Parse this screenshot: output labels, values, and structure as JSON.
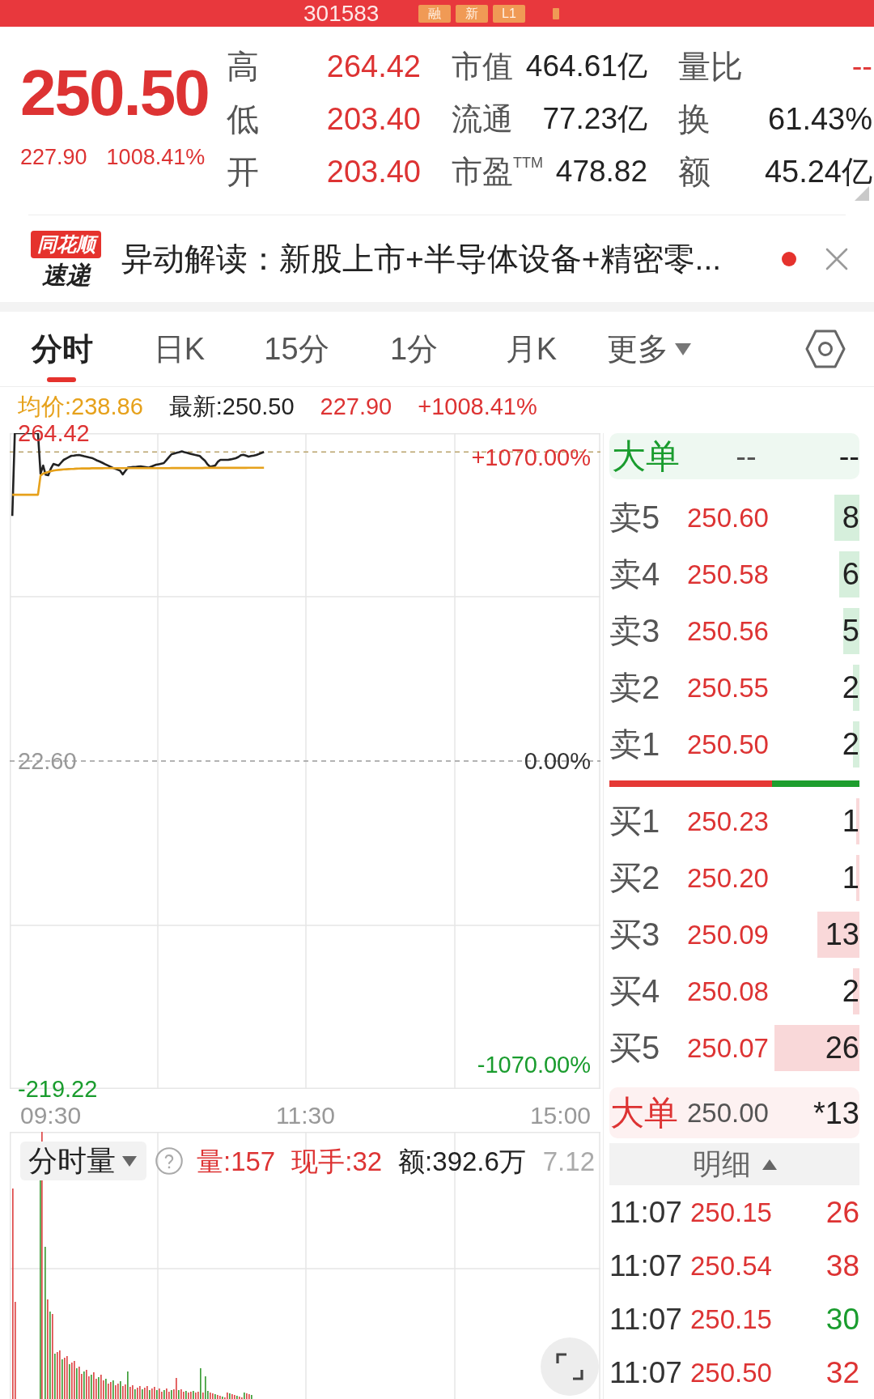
{
  "header": {
    "code": "301583",
    "badges": [
      "融",
      "新",
      "L1"
    ]
  },
  "quote": {
    "price": "250.50",
    "change": "227.90",
    "change_pct": "1008.41%",
    "col_1": [
      {
        "label": "高",
        "value": "264.42"
      },
      {
        "label": "低",
        "value": "203.40"
      },
      {
        "label": "开",
        "value": "203.40"
      }
    ],
    "col_2": [
      {
        "label": "市值",
        "value": "464.61亿"
      },
      {
        "label": "流通",
        "value": "77.23亿"
      },
      {
        "label": "市盈$^{TTM}$",
        "value": "478.82"
      }
    ],
    "col_3": [
      {
        "label": "量比",
        "value": "--",
        "color": "#e03c3c"
      },
      {
        "label": "换",
        "value": "61.43%",
        "color": "#222222"
      },
      {
        "label": "额",
        "value": "45.24亿",
        "color": "#222222"
      }
    ]
  },
  "news": {
    "logo_title": "同花顺",
    "logo_subtitle": "速递",
    "text": "异动解读：新股上市+半导体设备+精密零...",
    "unread": true
  },
  "tabs": [
    {
      "label": "分时",
      "selected": true,
      "kind": "tab"
    },
    {
      "label": "日K",
      "selected": false,
      "kind": "tab"
    },
    {
      "label": "15分",
      "selected": false,
      "kind": "tab"
    },
    {
      "label": "1分",
      "selected": false,
      "kind": "tab"
    },
    {
      "label": "月K",
      "selected": false,
      "kind": "tab"
    },
    {
      "label": "更多",
      "selected": false,
      "kind": "menu"
    }
  ],
  "chart": {
    "legend": [
      {
        "text": "均价:238.86",
        "color": "#e6a11b"
      },
      {
        "text": "最新:250.50",
        "color": "#222222"
      },
      {
        "text": "227.90",
        "color": "#dd3333"
      },
      {
        "text": "+1008.41%",
        "color": "#dd3333"
      }
    ],
    "chart_data": {
      "type": "line",
      "series": [
        {
          "color": "#222222",
          "values": [
            null,
            203.4,
            264.4,
            264.4,
            264.4,
            264.4,
            264.4,
            264.4,
            264.4,
            264.4,
            264.4,
            264.4,
            234.7,
            240.5,
            233.8,
            233.4,
            238.2,
            241.7,
            241.1,
            240.5,
            242.6,
            244.7,
            245.7,
            246.7,
            247.7,
            247.9,
            248.1,
            248.3,
            247.9,
            247.4,
            247.0,
            246.5,
            246.1,
            245.2,
            244.3,
            243.5,
            242.6,
            241.7,
            240.8,
            239.9,
            239.0,
            238.2,
            237.5,
            236.7,
            234.0,
            236.5,
            239.0,
            239.2,
            239.4,
            239.5,
            239.7,
            239.9,
            239.6,
            239.3,
            239.0,
            239.7,
            240.4,
            241.1,
            241.5,
            241.9,
            242.3,
            244.5,
            246.7,
            248.9,
            249.4,
            249.9,
            250.4,
            250.9,
            250.4,
            249.9,
            249.4,
            248.9,
            248.4,
            248.0,
            247.5,
            245.8,
            244.1,
            241.4,
            239.7,
            240.1,
            240.5,
            243.3,
            244.7,
            244.7,
            244.7,
            244.7,
            245.1,
            245.5,
            245.9,
            246.8,
            248.2,
            248.5,
            247.8,
            247.1,
            247.5,
            247.9,
            248.3,
            249.0,
            249.8,
            250.5,
            null,
            null,
            null,
            null,
            null,
            null,
            null,
            null,
            null,
            null,
            null,
            null,
            null,
            null,
            null,
            null,
            null,
            null,
            null,
            null,
            null,
            null,
            null,
            null,
            null,
            null,
            null,
            null,
            null,
            null,
            null,
            null,
            null,
            null,
            null,
            null,
            null,
            null,
            null,
            null,
            null,
            null,
            null,
            null,
            null,
            null,
            null,
            null,
            null,
            null,
            null,
            null,
            null,
            null,
            null,
            null,
            null,
            null,
            null,
            null,
            null,
            null,
            null,
            null,
            null,
            null,
            null,
            null,
            null,
            null,
            null,
            null,
            null,
            null,
            null,
            null,
            null,
            null,
            null,
            null,
            null,
            null,
            null,
            null,
            null,
            null,
            null,
            null,
            null,
            null,
            null,
            null,
            null,
            null,
            null,
            null,
            null,
            null,
            null,
            null,
            null,
            null,
            null,
            null,
            null,
            null,
            null,
            null,
            null,
            null,
            null,
            null,
            null,
            null,
            null,
            null,
            null,
            null,
            null,
            null,
            null,
            null,
            null,
            null,
            null,
            null,
            null,
            null,
            null,
            null,
            null
          ]
        },
        {
          "color": "#e6a11b",
          "values": [
            null,
            219.0,
            219.0,
            219.0,
            219.0,
            219.0,
            219.0,
            219.0,
            219.0,
            219.0,
            219.0,
            219.0,
            233.0,
            234.6,
            235.2,
            235.8,
            236.4,
            236.8,
            237.1,
            237.3,
            237.5,
            237.7,
            237.8,
            237.9,
            238.0,
            238.1,
            238.2,
            238.3,
            238.4,
            238.4,
            238.4,
            238.4,
            238.5,
            238.5,
            238.5,
            238.5,
            238.5,
            238.6,
            238.6,
            238.6,
            238.6,
            238.6,
            238.6,
            238.6,
            238.6,
            238.6,
            238.6,
            238.6,
            238.6,
            238.6,
            238.6,
            238.6,
            238.6,
            238.6,
            238.6,
            238.6,
            238.6,
            238.6,
            238.6,
            238.6,
            238.6,
            238.6,
            238.6,
            238.7,
            238.7,
            238.7,
            238.7,
            238.7,
            238.7,
            238.7,
            238.7,
            238.7,
            238.7,
            238.7,
            238.7,
            238.7,
            238.8,
            238.8,
            238.8,
            238.8,
            238.8,
            238.8,
            238.8,
            238.8,
            238.8,
            238.8,
            238.8,
            238.8,
            238.8,
            238.8,
            238.8,
            238.8,
            238.8,
            238.9,
            238.9,
            238.9,
            238.9,
            238.9,
            238.9,
            238.9,
            null,
            null,
            null,
            null,
            null,
            null,
            null,
            null,
            null,
            null,
            null,
            null,
            null,
            null,
            null,
            null,
            null,
            null,
            null,
            null,
            null,
            null,
            null,
            null,
            null,
            null,
            null,
            null,
            null,
            null,
            null,
            null,
            null,
            null,
            null,
            null,
            null,
            null,
            null,
            null,
            null,
            null,
            null,
            null,
            null,
            null,
            null,
            null,
            null,
            null,
            null,
            null,
            null,
            null,
            null,
            null,
            null,
            null,
            null,
            null,
            null,
            null,
            null,
            null,
            null,
            null,
            null,
            null,
            null,
            null,
            null,
            null,
            null,
            null,
            null,
            null,
            null,
            null,
            null,
            null,
            null,
            null,
            null,
            null,
            null,
            null,
            null,
            null,
            null,
            null,
            null,
            null,
            null,
            null,
            null,
            null,
            null,
            null,
            null,
            null,
            null,
            null,
            null,
            null,
            null,
            null,
            null,
            null,
            null,
            null,
            null,
            null,
            null,
            null,
            null,
            null,
            null,
            null,
            null,
            null,
            null,
            null,
            null,
            null,
            null,
            null,
            null,
            null,
            null,
            null,
            null
          ]
        }
      ],
      "ylim": [
        -219.22,
        264.42
      ],
      "yticks": [
        {
          "value": 264.42,
          "label": "264.42"
        },
        {
          "value": 22.6,
          "label": "22.60"
        },
        {
          "value": -219.22,
          "label": "-219.22"
        }
      ],
      "ref_lines": [
        {
          "axis": "y",
          "value": 22.6,
          "color": "#9a9a9a"
        },
        {
          "axis": "y",
          "value": 250.5,
          "color": "#b9a46c"
        }
      ]
    },
    "pct_labels": [
      "+1070.00%",
      "0.00%",
      "-1070.00%"
    ],
    "time_labels": [
      "09:30",
      "11:30",
      "15:00"
    ]
  },
  "volume": {
    "selector": "分时量",
    "stats": [
      {
        "text": "量:157",
        "color": "#dd3333"
      },
      {
        "text": "现手:32",
        "color": "#dd3333"
      },
      {
        "text": "额:392.6万",
        "color": "#222222"
      }
    ],
    "date": "7.12"
  },
  "order_book": {
    "header": {
      "label": "大单",
      "col_2": "--",
      "col_3": "--"
    },
    "asks": [
      {
        "label": "卖5",
        "price": "250.60",
        "volume": "8",
        "level": 0.1
      },
      {
        "label": "卖4",
        "price": "250.58",
        "volume": "6",
        "level": 0.08
      },
      {
        "label": "卖3",
        "price": "250.56",
        "volume": "5",
        "level": 0.065
      },
      {
        "label": "卖2",
        "price": "250.55",
        "volume": "2",
        "level": 0.026
      },
      {
        "label": "卖1",
        "price": "250.50",
        "volume": "2",
        "level": 0.026
      }
    ],
    "ratio_bar": {
      "level": 0.65
    },
    "bids": [
      {
        "label": "买1",
        "price": "250.23",
        "volume": "1",
        "level": 0.013
      },
      {
        "label": "买2",
        "price": "250.20",
        "volume": "1",
        "level": 0.013
      },
      {
        "label": "买3",
        "price": "250.09",
        "volume": "13",
        "level": 0.168
      },
      {
        "label": "买4",
        "price": "250.08",
        "volume": "2",
        "level": 0.026
      },
      {
        "label": "买5",
        "price": "250.07",
        "volume": "26",
        "level": 0.339
      }
    ],
    "big_order": {
      "label": "大单",
      "price": "250.00",
      "volume": "*13"
    }
  },
  "trades": {
    "header": "明细",
    "rows": [
      {
        "time": "11:07",
        "price": "250.15",
        "volume": "26",
        "color": "#dd3333"
      },
      {
        "time": "11:07",
        "price": "250.54",
        "volume": "38",
        "color": "#dd3333"
      },
      {
        "time": "11:07",
        "price": "250.15",
        "volume": "30",
        "color": "#1a9c2e"
      },
      {
        "time": "11:07",
        "price": "250.50",
        "volume": "32",
        "color": "#dd3333"
      }
    ]
  }
}
